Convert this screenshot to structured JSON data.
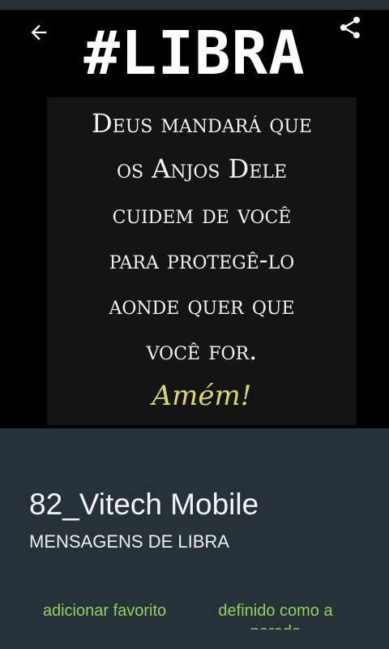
{
  "toolbar": {
    "back_icon": "arrow-left-icon",
    "share_icon": "share-icon"
  },
  "image": {
    "hashtag": "#LIBRA",
    "quote_lines": [
      "Deus mandará que",
      "os Anjos Dele",
      "cuidem de você",
      "para protegê-lo",
      "aonde quer que",
      "você for."
    ],
    "closing": "Amém!"
  },
  "details": {
    "title": "82_Vitech Mobile",
    "subtitle": "MENSAGENS DE LIBRA"
  },
  "actions": {
    "favorite_label": "adicionar favorito",
    "wallpaper_label": "definido como a parede"
  },
  "colors": {
    "panel_background": "#263238",
    "accent_green": "#9ccc65",
    "amem_yellow": "#d9d96a"
  }
}
